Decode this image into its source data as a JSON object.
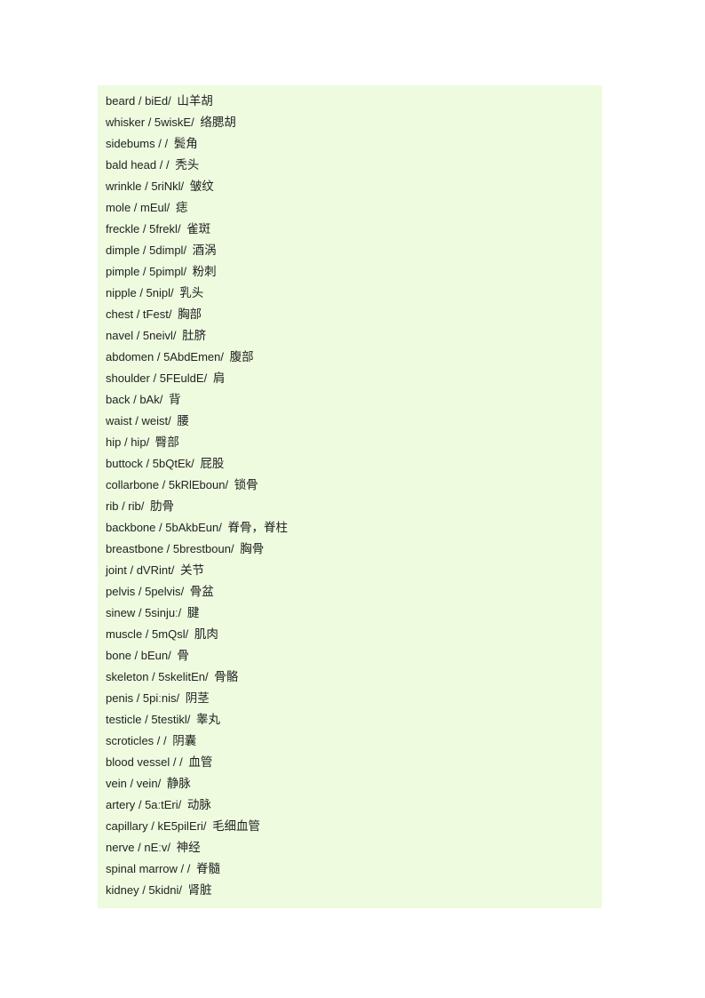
{
  "document": {
    "background_color": "#ffffff",
    "block_background_color": "#eefbdf",
    "text_color": "#222222",
    "separator": "/",
    "vocabulary": [
      {
        "term": "beard",
        "phonetic": "biEd",
        "gloss": "山羊胡"
      },
      {
        "term": "whisker",
        "phonetic": "5wiskE",
        "gloss": "络腮胡"
      },
      {
        "term": "sidebums",
        "phonetic": "",
        "gloss": "鬓角"
      },
      {
        "term": "bald head",
        "phonetic": "",
        "gloss": "秃头"
      },
      {
        "term": "wrinkle",
        "phonetic": "5riNkl",
        "gloss": "皱纹"
      },
      {
        "term": "mole",
        "phonetic": "mEul",
        "gloss": "痣"
      },
      {
        "term": "freckle",
        "phonetic": "5frekl",
        "gloss": "雀斑"
      },
      {
        "term": "dimple",
        "phonetic": "5dimpl",
        "gloss": "酒涡"
      },
      {
        "term": "pimple",
        "phonetic": "5pimpl",
        "gloss": "粉刺"
      },
      {
        "term": "nipple",
        "phonetic": "5nipl",
        "gloss": "乳头"
      },
      {
        "term": "chest",
        "phonetic": "tFest",
        "gloss": "胸部"
      },
      {
        "term": "navel",
        "phonetic": "5neivl",
        "gloss": "肚脐"
      },
      {
        "term": "abdomen",
        "phonetic": "5AbdEmen",
        "gloss": "腹部"
      },
      {
        "term": "shoulder",
        "phonetic": "5FEuldE",
        "gloss": "肩"
      },
      {
        "term": "back",
        "phonetic": "bAk",
        "gloss": "背"
      },
      {
        "term": "waist",
        "phonetic": "weist",
        "gloss": "腰"
      },
      {
        "term": "hip",
        "phonetic": "hip",
        "gloss": "臀部"
      },
      {
        "term": "buttock",
        "phonetic": "5bQtEk",
        "gloss": "屁股"
      },
      {
        "term": "collarbone",
        "phonetic": "5kRlEboun",
        "gloss": "锁骨"
      },
      {
        "term": "rib",
        "phonetic": "rib",
        "gloss": "肋骨"
      },
      {
        "term": "backbone",
        "phonetic": "5bAkbEun",
        "gloss": "脊骨，脊柱"
      },
      {
        "term": "breastbone",
        "phonetic": "5brestboun",
        "gloss": "胸骨"
      },
      {
        "term": "joint",
        "phonetic": "dVRint",
        "gloss": "关节"
      },
      {
        "term": "pelvis",
        "phonetic": "5pelvis",
        "gloss": "骨盆"
      },
      {
        "term": "sinew",
        "phonetic": "5sinjuː",
        "gloss": "腱"
      },
      {
        "term": "muscle",
        "phonetic": "5mQsl",
        "gloss": "肌肉"
      },
      {
        "term": "bone",
        "phonetic": "bEun",
        "gloss": "骨"
      },
      {
        "term": "skeleton",
        "phonetic": "5skelitEn",
        "gloss": "骨骼"
      },
      {
        "term": "penis",
        "phonetic": "5piːnis",
        "gloss": "阴茎"
      },
      {
        "term": "testicle",
        "phonetic": "5testikl",
        "gloss": "睾丸"
      },
      {
        "term": "scroticles",
        "phonetic": "",
        "gloss": "阴囊"
      },
      {
        "term": "blood vessel",
        "phonetic": "",
        "gloss": "血管"
      },
      {
        "term": "vein",
        "phonetic": "vein",
        "gloss": "静脉"
      },
      {
        "term": "artery",
        "phonetic": "5aːtEri",
        "gloss": "动脉"
      },
      {
        "term": "capillary",
        "phonetic": "kE5pilEri",
        "gloss": "毛细血管"
      },
      {
        "term": "nerve",
        "phonetic": "nEːv",
        "gloss": "神经"
      },
      {
        "term": "spinal marrow",
        "phonetic": "",
        "gloss": "脊髓"
      },
      {
        "term": "kidney",
        "phonetic": "5kidni",
        "gloss": "肾脏"
      }
    ]
  }
}
